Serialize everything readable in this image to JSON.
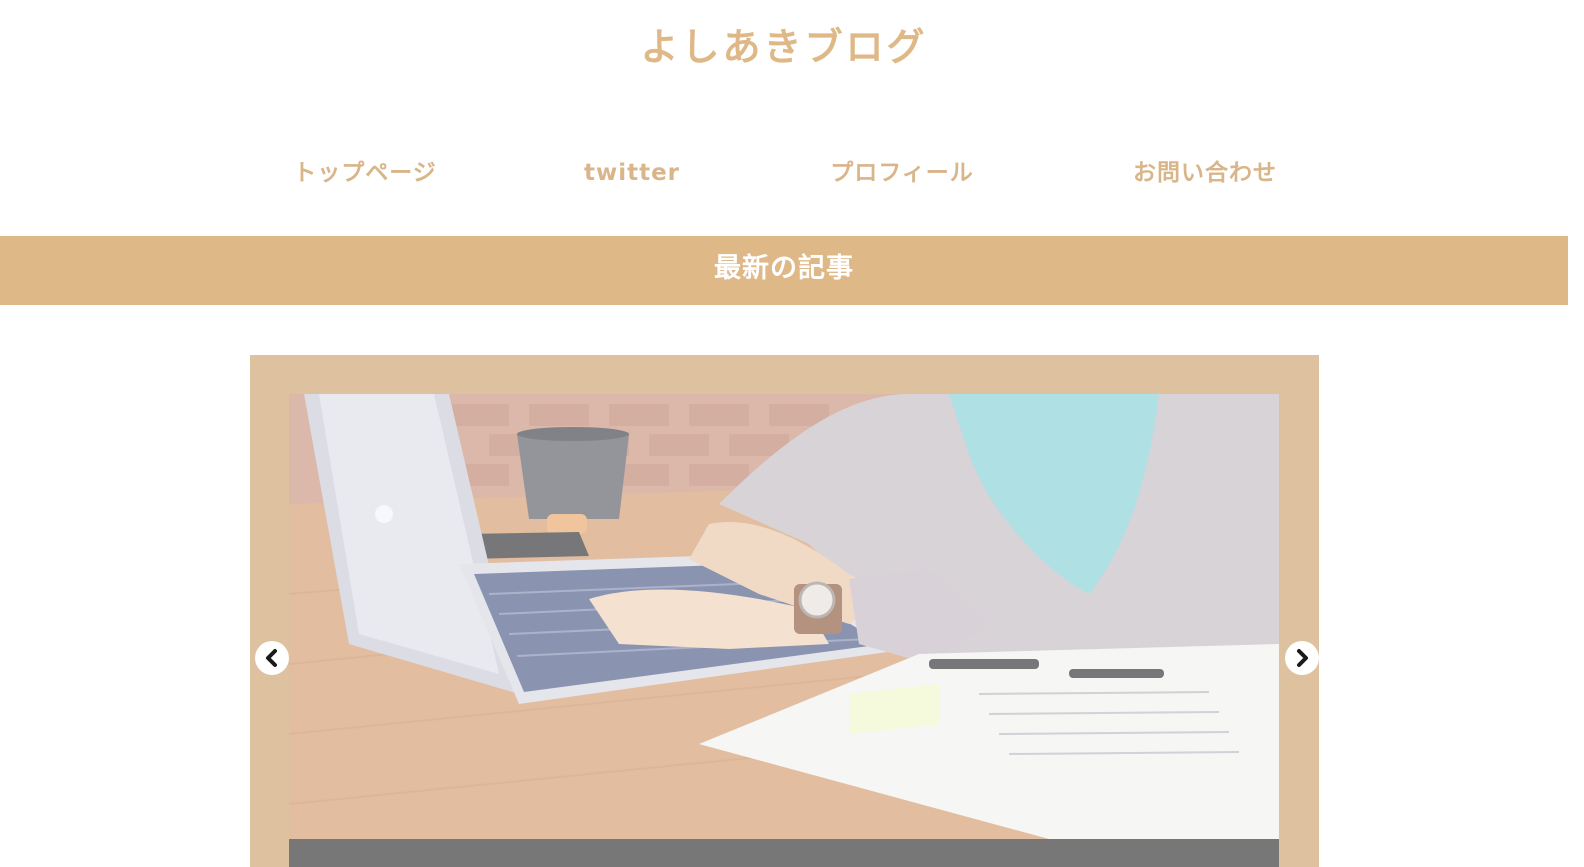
{
  "site": {
    "title": "よしあきブログ"
  },
  "nav": {
    "items": [
      {
        "label": "トップページ"
      },
      {
        "label": "twitter"
      },
      {
        "label": "プロフィール"
      },
      {
        "label": "お問い合わせ"
      }
    ]
  },
  "section": {
    "title": "最新の記事"
  },
  "slider": {
    "prev_icon": "chevron-left-icon",
    "next_icon": "chevron-right-icon"
  },
  "colors": {
    "accent": "#dfb887",
    "frame": "#dec2a0",
    "caption": "#777777"
  }
}
